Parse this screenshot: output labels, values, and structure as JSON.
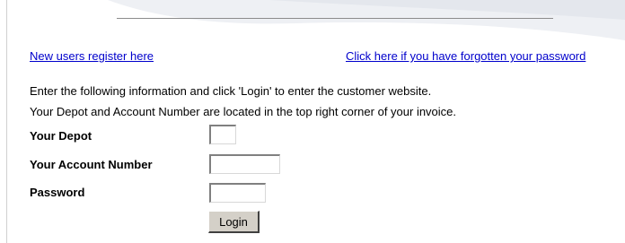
{
  "links": {
    "register": "New users register here",
    "forgot_password": "Click here if you have forgotten your password"
  },
  "instructions": {
    "line1": "Enter the following information and click 'Login' to enter the customer website.",
    "line2": "Your Depot and Account Number are located in the top right corner of your invoice."
  },
  "form": {
    "depot_label": "Your Depot",
    "depot_value": "",
    "account_label": "Your Account Number",
    "account_value": "",
    "password_label": "Password",
    "password_value": "",
    "login_button": "Login"
  },
  "colors": {
    "link": "#0000cc",
    "button_face": "#d4d0c8",
    "swoosh": "#eef0f4"
  }
}
